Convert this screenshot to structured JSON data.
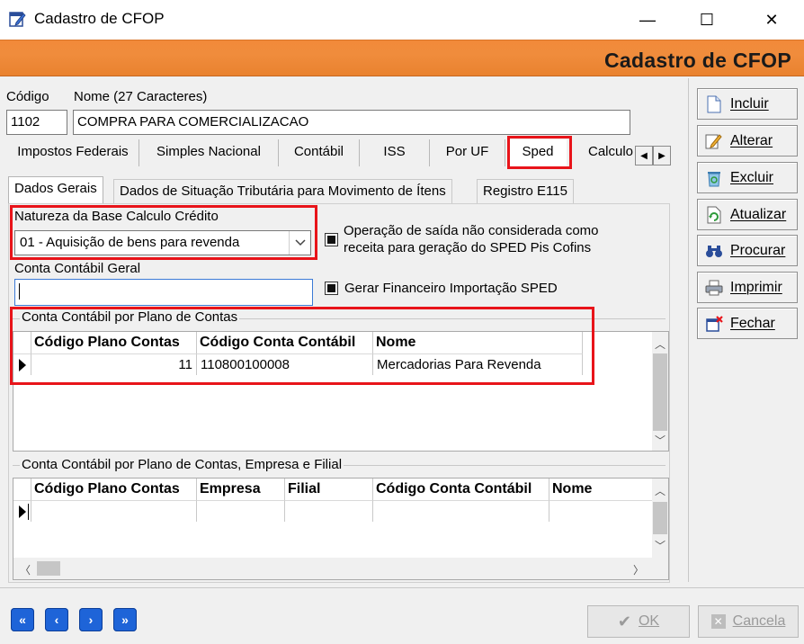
{
  "window": {
    "title": "Cadastro de CFOP",
    "minimize": "—",
    "maximize": "☐",
    "close": "✕"
  },
  "header": {
    "title": "Cadastro de CFOP"
  },
  "form": {
    "codigo_label": "Código",
    "codigo_value": "1102",
    "nome_label": "Nome (27 Caracteres)",
    "nome_value": "COMPRA PARA COMERCIALIZACAO"
  },
  "tabs_main": [
    {
      "label": "Impostos Federais"
    },
    {
      "label": "Simples Nacional"
    },
    {
      "label": "Contábil"
    },
    {
      "label": "ISS"
    },
    {
      "label": "Por UF"
    },
    {
      "label": "Sped"
    },
    {
      "label": "Calculo"
    }
  ],
  "tabs_sub": [
    {
      "label": "Dados Gerais"
    },
    {
      "label": "Dados de Situação Tributária para Movimento de Ítens"
    },
    {
      "label": "Registro E115"
    }
  ],
  "sped": {
    "natureza_label": "Natureza da Base Calculo Crédito",
    "natureza_value": "01 - Aquisição de bens para revenda",
    "operacao_line1": "Operação de saída não considerada como",
    "operacao_line2": "receita para geração do SPED Pis Cofins",
    "conta_geral_label": "Conta Contábil Geral",
    "conta_geral_value": "",
    "gerar_financeiro_label": "Gerar Financeiro Importação SPED"
  },
  "grid1": {
    "caption": "Conta Contábil por Plano de Contas",
    "columns": [
      "Código Plano Contas",
      "Código Conta Contábil",
      "Nome"
    ],
    "rows": [
      {
        "codigo_plano": "11",
        "codigo_conta": "110800100008",
        "nome": "Mercadorias Para Revenda"
      }
    ]
  },
  "grid2": {
    "caption": "Conta Contábil por Plano de Contas,  Empresa e Filial",
    "columns": [
      "Código Plano Contas",
      "Empresa",
      "Filial",
      "Código Conta Contábil",
      "Nome"
    ]
  },
  "side_buttons": [
    {
      "label": "Incluir",
      "icon": "document-icon"
    },
    {
      "label": "Alterar",
      "icon": "edit-icon"
    },
    {
      "label": "Excluir",
      "icon": "recycle-bin-icon"
    },
    {
      "label": "Atualizar",
      "icon": "refresh-icon"
    },
    {
      "label": "Procurar",
      "icon": "binoculars-icon"
    },
    {
      "label": "Imprimir",
      "icon": "printer-icon"
    },
    {
      "label": "Fechar",
      "icon": "exit-icon"
    }
  ],
  "bottom": {
    "nav_first": "«",
    "nav_prev": "‹",
    "nav_next": "›",
    "nav_last": "»",
    "ok_label": "OK",
    "cancel_label": "Cancela"
  },
  "colors": {
    "header_orange": "#f08c3c",
    "highlight_red": "#e8141a",
    "nav_blue": "#1e64d8"
  }
}
